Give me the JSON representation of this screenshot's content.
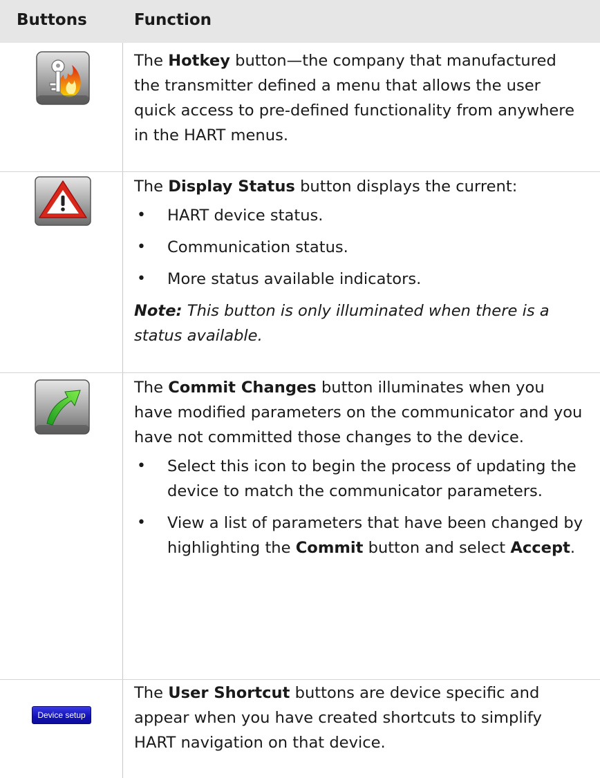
{
  "header": {
    "col_buttons": "Buttons",
    "col_function": "Function"
  },
  "rows": [
    {
      "icon": "hotkey-icon",
      "pre": "The ",
      "name": "Hotkey",
      "post": " button—the company that manufactured the transmitter defined a menu that allows the user quick access to pre-defined functionality from anywhere in the HART menus."
    },
    {
      "icon": "warning-triangle-icon",
      "pre": "The ",
      "name": "Display Status",
      "post": " button displays the current:",
      "bullets": [
        "HART device status.",
        "Communication status.",
        "More status available indicators."
      ],
      "note_label": "Note:",
      "note_text": " This button is only illuminated when there is a status available."
    },
    {
      "icon": "commit-arrow-icon",
      "pre": "The ",
      "name": "Commit Changes",
      "post": " button illuminates when you have modified parameters on the communicator and you have not committed those changes to the device.",
      "bullet1": "Select this icon to begin the process of updating the device to match the communicator parameters.",
      "bullet2_a": "View a list of parameters that have been changed by highlighting the ",
      "bullet2_b": "Commit",
      "bullet2_c": " button and select ",
      "bullet2_d": "Accept",
      "bullet2_e": "."
    },
    {
      "icon": "device-setup-button",
      "button_label": "Device setup",
      "pre": "The ",
      "name": "User Shortcut",
      "post": " buttons are device specific and appear when you have created shortcuts to simplify HART navigation on that device."
    }
  ]
}
